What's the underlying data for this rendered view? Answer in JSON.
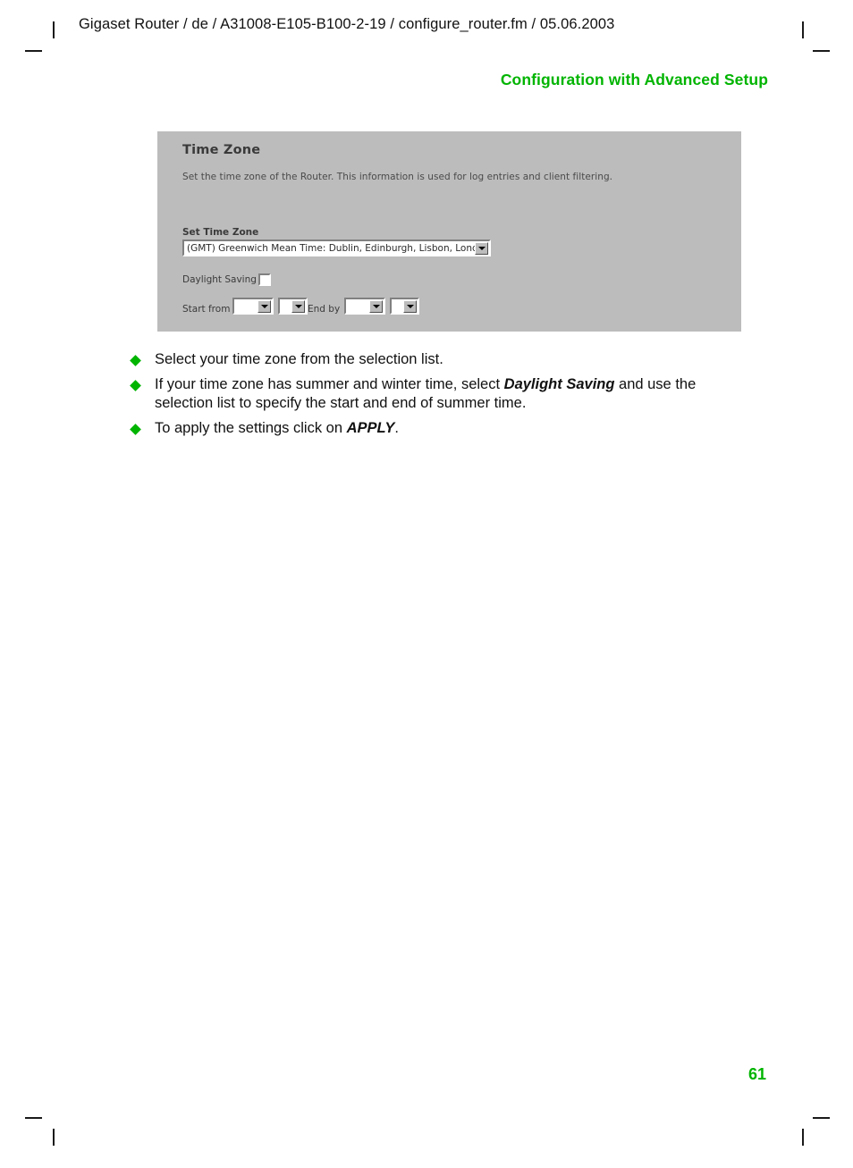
{
  "page": {
    "running_header": "Gigaset Router / de / A31008-E105-B100-2-19 / configure_router.fm / 05.06.2003",
    "chapter_title": "Configuration with Advanced Setup",
    "page_number": "61",
    "accent_color": "#00b400",
    "text_color": "#111111"
  },
  "screenshot": {
    "panel_background": "#bcbcbc",
    "title": "Time Zone",
    "description": "Set the time zone of the Router. This information is used for log entries and client filtering.",
    "fields": {
      "set_time_zone": {
        "label": "Set Time Zone",
        "value": "(GMT) Greenwich Mean Time: Dublin, Edinburgh, Lisbon, London"
      },
      "daylight_saving": {
        "label": "Daylight Saving",
        "checked": false
      },
      "start_from": {
        "label": "Start from",
        "month_value": "",
        "day_value": ""
      },
      "end_by": {
        "label": "End by",
        "month_value": "",
        "day_value": ""
      }
    }
  },
  "instructions": [
    {
      "pre": "Select your time zone from the selection list.",
      "emphasis": "",
      "post": ""
    },
    {
      "pre": "If your time zone has summer and winter time, select ",
      "emphasis": "Daylight Saving",
      "post": " and use the selection list to specify the start and end of summer time."
    },
    {
      "pre": "To apply the settings click on ",
      "emphasis": "APPLY",
      "post": "."
    }
  ]
}
